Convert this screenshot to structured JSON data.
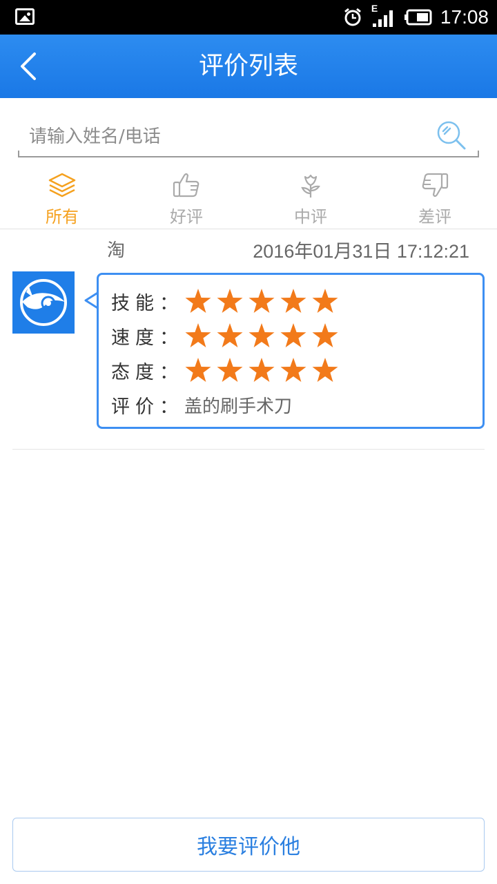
{
  "status_bar": {
    "time": "17:08",
    "network_label": "E",
    "icons": [
      "image-notification-icon",
      "alarm-icon",
      "signal-icon",
      "battery-icon"
    ]
  },
  "header": {
    "title": "评价列表",
    "back_icon": "chevron-left-icon"
  },
  "search": {
    "placeholder": "请输入姓名/电话",
    "value": "",
    "icon": "search-icon"
  },
  "tabs": [
    {
      "label": "所有",
      "icon": "layers-icon",
      "active": true
    },
    {
      "label": "好评",
      "icon": "thumbs-up-icon",
      "active": false
    },
    {
      "label": "中评",
      "icon": "flower-icon",
      "active": false
    },
    {
      "label": "差评",
      "icon": "thumbs-down-icon",
      "active": false
    }
  ],
  "reviews": [
    {
      "reviewer": "淘",
      "date": "2016年01月31日 17:12:21",
      "ratings": [
        {
          "label": "技能：",
          "stars": 5
        },
        {
          "label": "速度：",
          "stars": 5
        },
        {
          "label": "态度：",
          "stars": 5
        }
      ],
      "comment_label": "评价：",
      "comment": "盖的刷手术刀"
    }
  ],
  "bottom_button": {
    "label": "我要评价他"
  },
  "colors": {
    "header_blue": "#1a78e6",
    "tab_active": "#f5a11f",
    "tab_inactive": "#aaaaaa",
    "star_orange": "#f27a1a",
    "bubble_border": "#3d8ff2",
    "button_text": "#2a7fe0"
  }
}
